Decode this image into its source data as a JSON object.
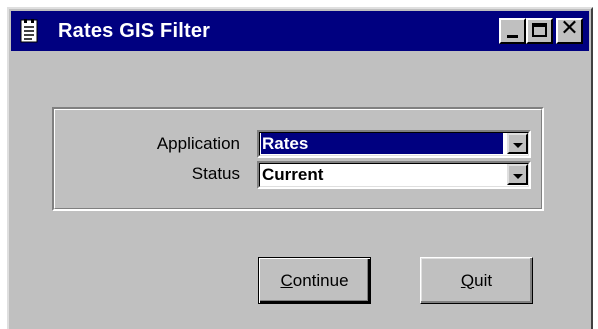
{
  "window": {
    "title": "Rates GIS Filter",
    "controls": {
      "minimize": "minimize-icon",
      "maximize": "maximize-icon",
      "close": "close-icon"
    },
    "app_icon": "document-icon"
  },
  "form": {
    "application": {
      "label": "Application",
      "value": "Rates"
    },
    "status": {
      "label": "Status",
      "value": "Current"
    }
  },
  "buttons": {
    "continue": {
      "accel": "C",
      "rest": "ontinue"
    },
    "quit": {
      "accel": "Q",
      "rest": "uit"
    }
  },
  "colors": {
    "titlebar": "#000080",
    "face": "#c0c0c0",
    "selection": "#000080"
  }
}
